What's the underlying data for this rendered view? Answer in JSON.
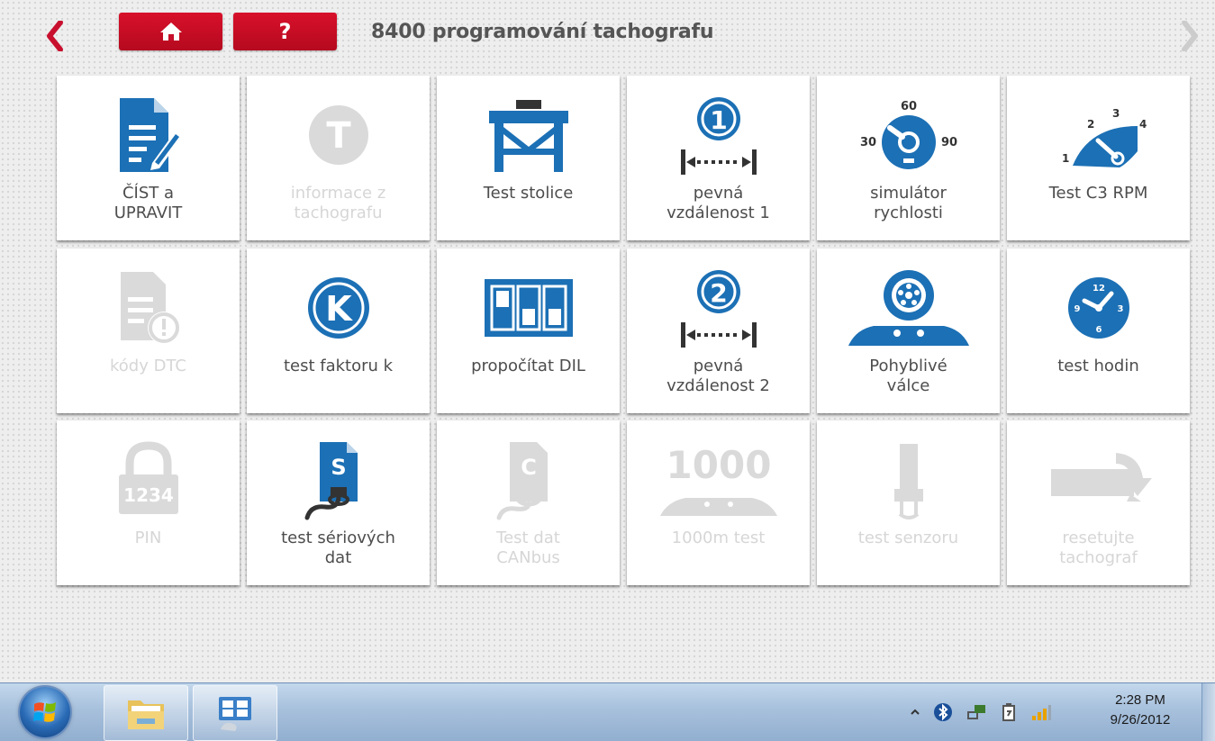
{
  "header": {
    "title": "8400 programování tachografu",
    "help_label": "?"
  },
  "colors": {
    "accent_red": "#c8102e",
    "icon_blue": "#1c70b5",
    "disabled_gray": "#dadada"
  },
  "tiles": [
    {
      "label": "ČÍST a\nUPRAVIT",
      "icon": "read-edit-icon",
      "enabled": true
    },
    {
      "label": "informace z\ntachografu",
      "icon": "tachograph-info-icon",
      "enabled": false
    },
    {
      "label": "Test stolice",
      "icon": "test-bench-icon",
      "enabled": true
    },
    {
      "label": "pevná\nvzdálenost 1",
      "icon": "fixed-distance-1-icon",
      "enabled": true
    },
    {
      "label": "simulátor\nrychlosti",
      "icon": "speed-simulator-icon",
      "enabled": true
    },
    {
      "label": "Test C3 RPM",
      "icon": "rpm-gauge-icon",
      "enabled": true
    },
    {
      "label": "kódy DTC",
      "icon": "dtc-codes-icon",
      "enabled": false
    },
    {
      "label": "test faktoru k",
      "icon": "k-factor-icon",
      "enabled": true
    },
    {
      "label": "propočítat DIL",
      "icon": "dil-switch-icon",
      "enabled": true
    },
    {
      "label": "pevná\nvzdálenost 2",
      "icon": "fixed-distance-2-icon",
      "enabled": true
    },
    {
      "label": "Pohyblivé\nválce",
      "icon": "rolling-road-icon",
      "enabled": true
    },
    {
      "label": "test hodin",
      "icon": "clock-test-icon",
      "enabled": true
    },
    {
      "label": "PIN",
      "icon": "pin-lock-icon",
      "enabled": false
    },
    {
      "label": "test sériových\ndat",
      "icon": "serial-data-icon",
      "enabled": true
    },
    {
      "label": "Test dat\nCANbus",
      "icon": "canbus-data-icon",
      "enabled": false
    },
    {
      "label": "1000m test",
      "icon": "1000m-test-icon",
      "enabled": false
    },
    {
      "label": "test senzoru",
      "icon": "sensor-test-icon",
      "enabled": false
    },
    {
      "label": "resetujte\ntachograf",
      "icon": "reset-tachograph-icon",
      "enabled": false
    }
  ],
  "icon_text": {
    "fixed1": "1",
    "fixed2": "2",
    "speed_top": "60",
    "speed_left": "30",
    "speed_right": "90",
    "rpm_1": "1",
    "rpm_2": "2",
    "rpm_3": "3",
    "rpm_4": "4",
    "k": "K",
    "clock_12": "12",
    "clock_3": "3",
    "clock_6": "6",
    "clock_9": "9",
    "pin": "1234",
    "serial": "S",
    "canbus": "C",
    "m1000": "1000",
    "tacho": "T"
  },
  "taskbar": {
    "time": "2:28 PM",
    "date": "9/26/2012",
    "tray_icons": [
      "show-hidden-icons-icon",
      "bluetooth-icon",
      "network-icon",
      "power-icon",
      "signal-strength-icon"
    ]
  }
}
